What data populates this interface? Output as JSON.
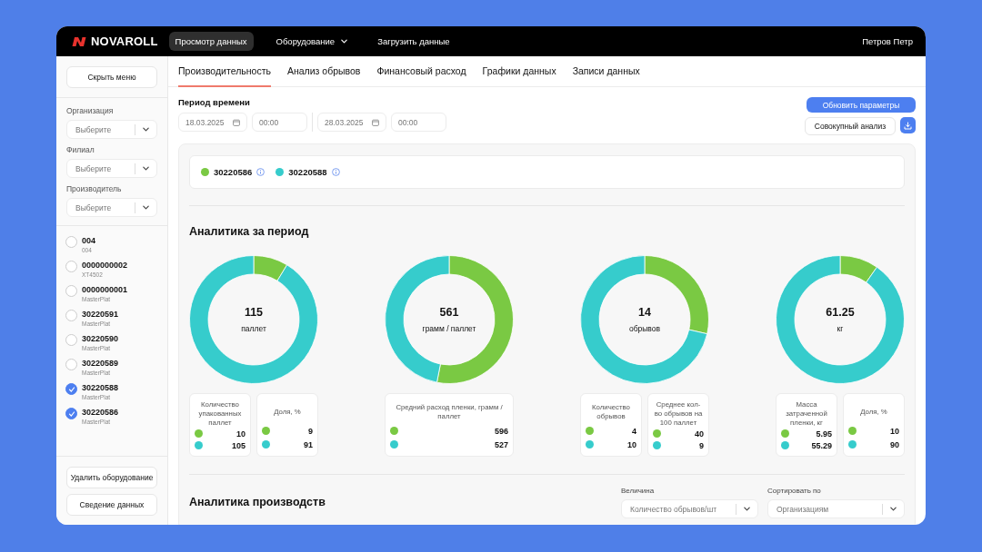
{
  "header": {
    "logo": "NOVAROLL",
    "nav": [
      {
        "label": "Просмотр данных",
        "kind": "link",
        "selected": true
      },
      {
        "label": "Оборудование",
        "kind": "dropdown",
        "selected": false
      },
      {
        "label": "Загрузить данные",
        "kind": "link",
        "selected": false
      }
    ],
    "user": "Петров Петр"
  },
  "sidebar": {
    "toggle_button": "Скрыть меню",
    "filters": [
      {
        "label": "Организация",
        "placeholder": "Выберите"
      },
      {
        "label": "Филиал",
        "placeholder": "Выберите"
      },
      {
        "label": "Производитель",
        "placeholder": "Выберите"
      }
    ],
    "equipment": [
      {
        "name": "004",
        "model": "004",
        "checked": false
      },
      {
        "name": "0000000002",
        "model": "XT4502",
        "checked": false
      },
      {
        "name": "0000000001",
        "model": "MasterPlat",
        "checked": false
      },
      {
        "name": "30220591",
        "model": "MasterPlat",
        "checked": false
      },
      {
        "name": "30220590",
        "model": "MasterPlat",
        "checked": false
      },
      {
        "name": "30220589",
        "model": "MasterPlat",
        "checked": false
      },
      {
        "name": "30220588",
        "model": "MasterPlat",
        "checked": true
      },
      {
        "name": "30220586",
        "model": "MasterPlat",
        "checked": true
      }
    ],
    "buttons": [
      "Удалить оборудование",
      "Сведение данных"
    ]
  },
  "tabs": [
    {
      "label": "Производительность",
      "selected": true
    },
    {
      "label": "Анализ обрывов",
      "selected": false
    },
    {
      "label": "Финансовый расход",
      "selected": false
    },
    {
      "label": "Графики данных",
      "selected": false
    },
    {
      "label": "Записи данных",
      "selected": false
    }
  ],
  "period": {
    "label": "Период времени",
    "fields": [
      {
        "kind": "date",
        "value": "18.03.2025"
      },
      {
        "kind": "time",
        "value": "00:00"
      },
      {
        "kind": "date",
        "value": "28.03.2025"
      },
      {
        "kind": "time",
        "value": "00:00"
      }
    ]
  },
  "actions": {
    "update_button": "Обновить параметры",
    "aggregate_button": "Совокупный анализ"
  },
  "legend": [
    {
      "label": "30220586",
      "color": "#7ac943"
    },
    {
      "label": "30220588",
      "color": "#36cccc"
    }
  ],
  "period_analytics": {
    "title": "Аналитика за период",
    "donuts": [
      {
        "total": "115",
        "unit": "паллет",
        "cards": [
          {
            "title": "Количество упакованных паллет",
            "rows": [
              {
                "value": "10",
                "color": "#7ac943"
              },
              {
                "value": "105",
                "color": "#36cccc"
              }
            ]
          },
          {
            "title": "Доля, %",
            "rows": [
              {
                "value": "9",
                "color": "#7ac943"
              },
              {
                "value": "91",
                "color": "#36cccc"
              }
            ]
          }
        ]
      },
      {
        "total": "561",
        "unit": "грамм / паллет",
        "cards": [
          {
            "title": "Средний расход пленки, грамм / паллет",
            "rows": [
              {
                "value": "596",
                "color": "#7ac943"
              },
              {
                "value": "527",
                "color": "#36cccc"
              }
            ]
          }
        ]
      },
      {
        "total": "14",
        "unit": "обрывов",
        "cards": [
          {
            "title": "Количество обрывов",
            "rows": [
              {
                "value": "4",
                "color": "#7ac943"
              },
              {
                "value": "10",
                "color": "#36cccc"
              }
            ]
          },
          {
            "title": "Среднее кол-во обрывов на 100 паллет",
            "rows": [
              {
                "value": "40",
                "color": "#7ac943"
              },
              {
                "value": "9",
                "color": "#36cccc"
              }
            ]
          }
        ]
      },
      {
        "total": "61.25",
        "unit": "кг",
        "cards": [
          {
            "title": "Масса затраченной пленки, кг",
            "rows": [
              {
                "value": "5.95",
                "color": "#7ac943"
              },
              {
                "value": "55.29",
                "color": "#36cccc"
              }
            ]
          },
          {
            "title": "Доля, %",
            "rows": [
              {
                "value": "10",
                "color": "#7ac943"
              },
              {
                "value": "90",
                "color": "#36cccc"
              }
            ]
          }
        ]
      }
    ]
  },
  "production_analytics": {
    "title": "Аналитика производств",
    "selects": [
      {
        "label": "Величина",
        "value": "Количество обрывов/шт"
      },
      {
        "label": "Сортировать по",
        "value": "Организациям"
      }
    ]
  }
}
